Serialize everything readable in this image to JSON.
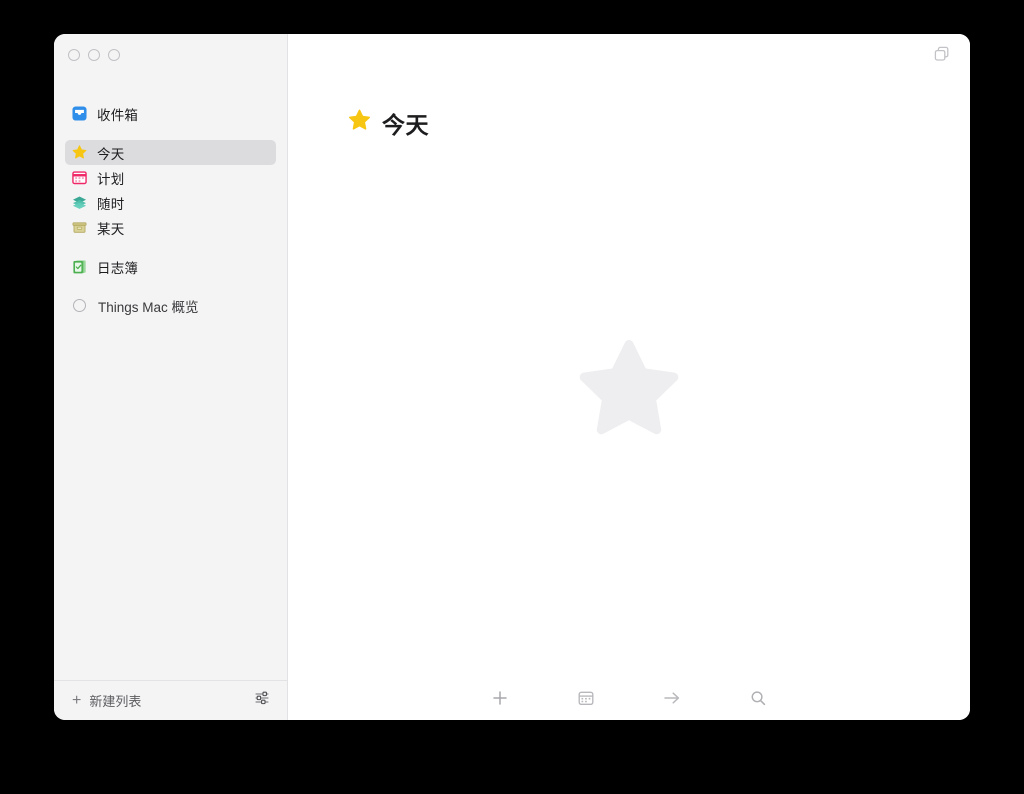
{
  "window": {
    "traffic_lights": [
      {
        "name": "close",
        "label": "关闭"
      },
      {
        "name": "minimize",
        "label": "最小化"
      },
      {
        "name": "zoom",
        "label": "缩放"
      }
    ],
    "toolbar_right_icon": "multiple-windows-icon"
  },
  "sidebar": {
    "inbox": {
      "label": "收件箱",
      "icon": "inbox-tray-icon",
      "icon_color": "#2f8eea"
    },
    "lists": [
      {
        "label": "今天",
        "icon": "star-icon",
        "icon_color": "#f7c613",
        "selected": true
      },
      {
        "label": "计划",
        "icon": "calendar-icon",
        "icon_color": "#ef2868",
        "selected": false
      },
      {
        "label": "随时",
        "icon": "layers-icon",
        "icon_color": "#3aa894",
        "selected": false
      },
      {
        "label": "某天",
        "icon": "box-icon",
        "icon_color": "#bdb169",
        "selected": false
      }
    ],
    "logbook": {
      "label": "日志簿",
      "icon": "logbook-book-icon",
      "icon_color": "#4cb050"
    },
    "projects": [
      {
        "label": "Things Mac 概览",
        "icon": "project-circle-icon"
      }
    ],
    "footer": {
      "new_list_label": "新建列表",
      "new_list_icon": "plus-icon",
      "settings_icon": "sliders-icon"
    }
  },
  "main": {
    "title": "今天",
    "title_icon": "star-icon",
    "title_icon_color": "#f7c613",
    "watermark_icon": "star-watermark-icon",
    "watermark_color": "#eeeef0",
    "footer_buttons": [
      {
        "name": "new-todo-button",
        "icon": "plus-icon",
        "label": "新建待办事项"
      },
      {
        "name": "when-button",
        "icon": "calendar-icon",
        "label": "何时"
      },
      {
        "name": "move-button",
        "icon": "arrow-right-icon",
        "label": "移动"
      },
      {
        "name": "search-button",
        "icon": "search-icon",
        "label": "搜索"
      }
    ]
  },
  "colors": {
    "window_bg": "#ffffff",
    "sidebar_bg": "#f4f4f5",
    "selection_bg": "#dcdcde",
    "text_primary": "#1d1d1f",
    "text_secondary": "#5d5d61",
    "icon_gray": "#b8b8bc",
    "desktop_bg": "#000000"
  }
}
